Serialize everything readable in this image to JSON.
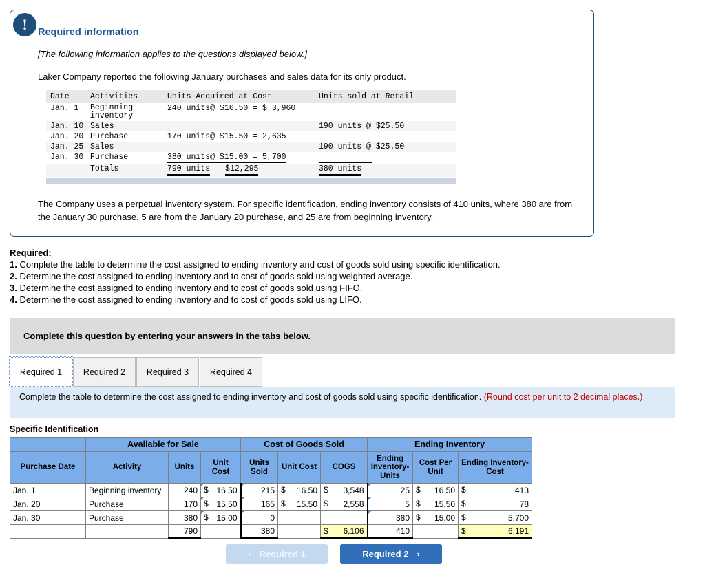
{
  "info_panel": {
    "icon": "exclamation-icon",
    "title": "Required information",
    "italic_note": "[The following information applies to the questions displayed below.]",
    "intro": "Laker Company reported the following January purchases and sales data for its only product.",
    "closing_text": "The Company uses a perpetual inventory system. For specific identification, ending inventory consists of 410 units, where 380 are from the January 30 purchase, 5 are from the January 20 purchase, and 25 are from beginning inventory.",
    "data_table": {
      "headers": [
        "Date",
        "Activities",
        "Units Acquired at Cost",
        "Units sold at Retail"
      ],
      "rows": [
        {
          "date": "Jan.  1",
          "activity_line1": "Beginning",
          "activity_line2": "inventory",
          "acquired": "240 units@ $16.50 = $  3,960",
          "sold": ""
        },
        {
          "date": "Jan. 10",
          "activity_line1": "Sales",
          "activity_line2": "",
          "acquired": "",
          "sold": "190 units @  $25.50"
        },
        {
          "date": "Jan. 20",
          "activity_line1": "Purchase",
          "activity_line2": "",
          "acquired": "170 units@ $15.50 =    2,635",
          "sold": ""
        },
        {
          "date": "Jan. 25",
          "activity_line1": "Sales",
          "activity_line2": "",
          "acquired": "",
          "sold": "190 units @  $25.50"
        },
        {
          "date": "Jan. 30",
          "activity_line1": "Purchase",
          "activity_line2": "",
          "acquired": "380 units@ $15.00 =    5,700",
          "sold": ""
        }
      ],
      "totals": {
        "label": "Totals",
        "units": "790 units",
        "cost": "$12,295",
        "sold": "380 units"
      }
    }
  },
  "required": {
    "heading": "Required:",
    "items": [
      {
        "num": "1.",
        "text": "Complete the table to determine the cost assigned to ending inventory and cost of goods sold using specific identification."
      },
      {
        "num": "2.",
        "text": "Determine the cost assigned to ending inventory and to cost of goods sold using weighted average."
      },
      {
        "num": "3.",
        "text": "Determine the cost assigned to ending inventory and to cost of goods sold using FIFO."
      },
      {
        "num": "4.",
        "text": "Determine the cost assigned to ending inventory and to cost of goods sold using LIFO."
      }
    ]
  },
  "complete_bar": {
    "text": "Complete this question by entering your answers in the tabs below."
  },
  "tabs": [
    {
      "label": "Required 1",
      "active": true
    },
    {
      "label": "Required 2",
      "active": false
    },
    {
      "label": "Required 3",
      "active": false
    },
    {
      "label": "Required 4",
      "active": false
    }
  ],
  "instruction": {
    "main": "Complete the table to determine the cost assigned to ending inventory and cost of goods sold using specific identification.",
    "note": "(Round cost per unit to 2 decimal places.)"
  },
  "answer": {
    "section_label": "Specific Identification",
    "group_headers": [
      "",
      "Available for Sale",
      "Cost of Goods Sold",
      "Ending Inventory"
    ],
    "column_headers": [
      "Purchase Date",
      "Activity",
      "Units",
      "Unit Cost",
      "Units Sold",
      "Unit Cost",
      "COGS",
      "Ending Inventory-Units",
      "Cost Per Unit",
      "Ending Inventory-Cost"
    ],
    "rows": [
      {
        "date": "Jan. 1",
        "activity": "Beginning inventory",
        "units": "240",
        "unit_cost": "16.50",
        "units_sold": "215",
        "cogs_unit_cost": "16.50",
        "cogs": "3,548",
        "ei_units": "25",
        "ei_cost_per_unit": "16.50",
        "ei_cost": "413"
      },
      {
        "date": "Jan. 20",
        "activity": "Purchase",
        "units": "170",
        "unit_cost": "15.50",
        "units_sold": "165",
        "cogs_unit_cost": "15.50",
        "cogs": "2,558",
        "ei_units": "5",
        "ei_cost_per_unit": "15.50",
        "ei_cost": "78"
      },
      {
        "date": "Jan. 30",
        "activity": "Purchase",
        "units": "380",
        "unit_cost": "15.00",
        "units_sold": "0",
        "cogs_unit_cost": "",
        "cogs": "",
        "ei_units": "380",
        "ei_cost_per_unit": "15.00",
        "ei_cost": "5,700"
      }
    ],
    "totals": {
      "units": "790",
      "units_sold": "380",
      "cogs": "6,106",
      "ei_units": "410",
      "ei_cost": "6,191"
    },
    "currency_symbol": "$"
  },
  "nav": {
    "prev_label": "Required 1",
    "next_label": "Required 2",
    "prev_chevron": "‹",
    "next_chevron": "›"
  },
  "colors": {
    "panel_border": "#1f4e79",
    "heading_blue": "#1f5897",
    "table_header_blue": "#7badea",
    "banner_blue": "#ddeaf7",
    "highlight_yellow": "#ffffbf",
    "note_red": "#c00000",
    "active_button_blue": "#3170b8",
    "disabled_button_blue": "#c5d9ee"
  }
}
